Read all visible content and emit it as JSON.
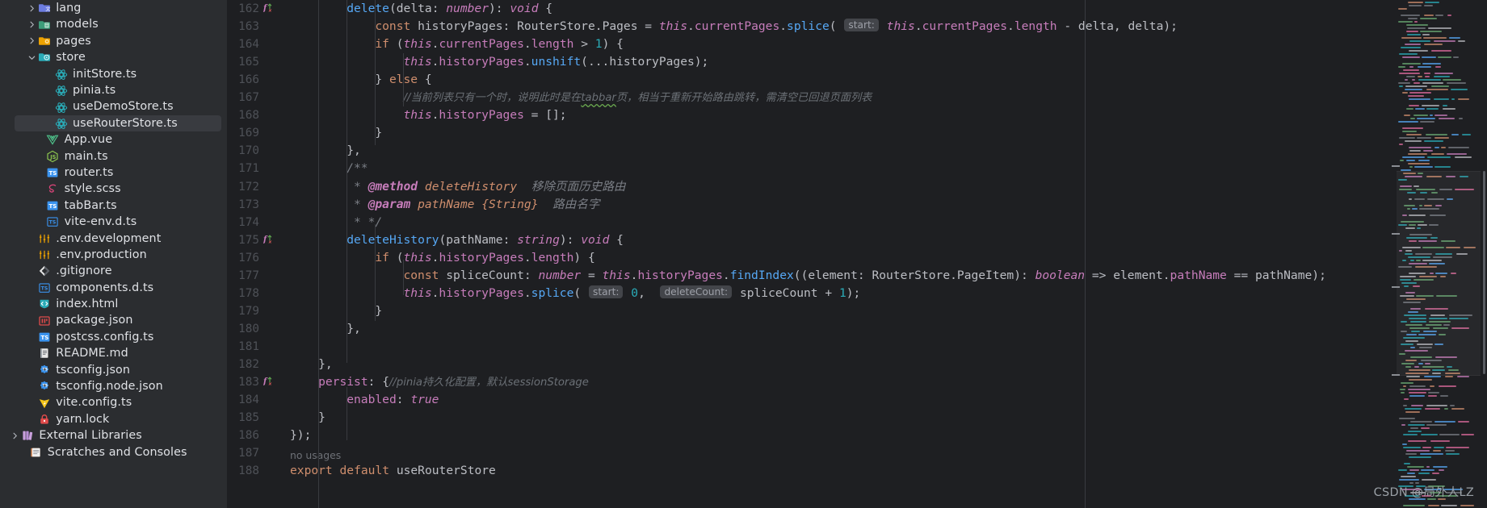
{
  "project_tree": {
    "items": [
      {
        "label": "lang",
        "icon": "folder-lang-icon",
        "indent": 3,
        "arrow": "right",
        "type": "folder",
        "selected": false
      },
      {
        "label": "models",
        "icon": "folder-models-icon",
        "indent": 3,
        "arrow": "right",
        "type": "folder",
        "selected": false
      },
      {
        "label": "pages",
        "icon": "folder-pages-icon",
        "indent": 3,
        "arrow": "right",
        "type": "folder",
        "selected": false
      },
      {
        "label": "store",
        "icon": "folder-store-icon",
        "indent": 3,
        "arrow": "down",
        "type": "folder",
        "selected": false
      },
      {
        "label": "initStore.ts",
        "icon": "pinia-store-icon",
        "indent": 5,
        "arrow": "none",
        "type": "file",
        "selected": false
      },
      {
        "label": "pinia.ts",
        "icon": "pinia-store-icon",
        "indent": 5,
        "arrow": "none",
        "type": "file",
        "selected": false
      },
      {
        "label": "useDemoStore.ts",
        "icon": "pinia-store-icon",
        "indent": 5,
        "arrow": "none",
        "type": "file",
        "selected": false
      },
      {
        "label": "useRouterStore.ts",
        "icon": "pinia-store-icon",
        "indent": 5,
        "arrow": "none",
        "type": "file",
        "selected": true
      },
      {
        "label": "App.vue",
        "icon": "vue-icon",
        "indent": 4,
        "arrow": "none",
        "type": "file",
        "selected": false
      },
      {
        "label": "main.ts",
        "icon": "js-icon",
        "indent": 4,
        "arrow": "none",
        "type": "file",
        "selected": false
      },
      {
        "label": "router.ts",
        "icon": "ts-icon",
        "indent": 4,
        "arrow": "none",
        "type": "file",
        "selected": false
      },
      {
        "label": "style.scss",
        "icon": "scss-icon",
        "indent": 4,
        "arrow": "none",
        "type": "file",
        "selected": false
      },
      {
        "label": "tabBar.ts",
        "icon": "ts-icon",
        "indent": 4,
        "arrow": "none",
        "type": "file",
        "selected": false
      },
      {
        "label": "vite-env.d.ts",
        "icon": "ts-def-icon",
        "indent": 4,
        "arrow": "none",
        "type": "file",
        "selected": false
      },
      {
        "label": ".env.development",
        "icon": "env-icon",
        "indent": 3,
        "arrow": "none",
        "type": "file",
        "selected": false
      },
      {
        "label": ".env.production",
        "icon": "env-icon",
        "indent": 3,
        "arrow": "none",
        "type": "file",
        "selected": false
      },
      {
        "label": ".gitignore",
        "icon": "gitignore-icon",
        "indent": 3,
        "arrow": "none",
        "type": "file",
        "selected": false
      },
      {
        "label": "components.d.ts",
        "icon": "ts-def-icon",
        "indent": 3,
        "arrow": "none",
        "type": "file",
        "selected": false
      },
      {
        "label": "index.html",
        "icon": "html-icon",
        "indent": 3,
        "arrow": "none",
        "type": "file",
        "selected": false
      },
      {
        "label": "package.json",
        "icon": "npm-icon",
        "indent": 3,
        "arrow": "none",
        "type": "file",
        "selected": false
      },
      {
        "label": "postcss.config.ts",
        "icon": "ts-icon",
        "indent": 3,
        "arrow": "none",
        "type": "file",
        "selected": false
      },
      {
        "label": "README.md",
        "icon": "markdown-icon",
        "indent": 3,
        "arrow": "none",
        "type": "file",
        "selected": false
      },
      {
        "label": "tsconfig.json",
        "icon": "tsconfig-icon",
        "indent": 3,
        "arrow": "none",
        "type": "file",
        "selected": false
      },
      {
        "label": "tsconfig.node.json",
        "icon": "tsconfig-icon",
        "indent": 3,
        "arrow": "none",
        "type": "file",
        "selected": false
      },
      {
        "label": "vite.config.ts",
        "icon": "vite-icon",
        "indent": 3,
        "arrow": "none",
        "type": "file",
        "selected": false
      },
      {
        "label": "yarn.lock",
        "icon": "lock-icon",
        "indent": 3,
        "arrow": "none",
        "type": "file",
        "selected": false
      },
      {
        "label": "External Libraries",
        "icon": "libraries-icon",
        "indent": 1,
        "arrow": "right",
        "type": "node",
        "selected": false
      },
      {
        "label": "Scratches and Consoles",
        "icon": "scratches-icon",
        "indent": 2,
        "arrow": "none",
        "type": "node",
        "selected": false
      }
    ]
  },
  "editor": {
    "first_line_number": 162,
    "gutter_marks": {
      "162": "override-method-icon",
      "175": "override-method-icon",
      "183": "override-method-icon"
    },
    "inlay_hints": {
      "163": "start:",
      "178_a": "start:",
      "178_b": "deleteCount:"
    },
    "no_usages_label": "no usages",
    "lines": [
      {
        "n": 162,
        "text": "        delete(delta: number): void {"
      },
      {
        "n": 163,
        "text": "            const historyPages: RouterStore.Pages = this.currentPages.splice( start: this.currentPages.length - delta, delta);"
      },
      {
        "n": 164,
        "text": "            if (this.currentPages.length > 1) {"
      },
      {
        "n": 165,
        "text": "                this.historyPages.unshift(...historyPages);"
      },
      {
        "n": 166,
        "text": "            } else {"
      },
      {
        "n": 167,
        "text": "                //当前列表只有一个时，说明此时是在tabbar页，相当于重新开始路由跳转，需清空已回退页面列表"
      },
      {
        "n": 168,
        "text": "                this.historyPages = [];"
      },
      {
        "n": 169,
        "text": "            }"
      },
      {
        "n": 170,
        "text": "        },"
      },
      {
        "n": 171,
        "text": "        /**"
      },
      {
        "n": 172,
        "text": "         * @method deleteHistory 移除页面历史路由"
      },
      {
        "n": 173,
        "text": "         * @param pathName {String} 路由名字"
      },
      {
        "n": 174,
        "text": "         * */"
      },
      {
        "n": 175,
        "text": "        deleteHistory(pathName: string): void {"
      },
      {
        "n": 176,
        "text": "            if (this.historyPages.length) {"
      },
      {
        "n": 177,
        "text": "                const spliceCount: number = this.historyPages.findIndex((element: RouterStore.PageItem): boolean => element.pathName == pathName);"
      },
      {
        "n": 178,
        "text": "                this.historyPages.splice( start: 0,  deleteCount: spliceCount + 1);"
      },
      {
        "n": 179,
        "text": "            }"
      },
      {
        "n": 180,
        "text": "        },"
      },
      {
        "n": 181,
        "text": ""
      },
      {
        "n": 182,
        "text": "    },"
      },
      {
        "n": 183,
        "text": "    persist: {//pinia持久化配置，默认sessionStorage"
      },
      {
        "n": 184,
        "text": "        enabled: true"
      },
      {
        "n": 185,
        "text": "    }"
      },
      {
        "n": 186,
        "text": "});"
      },
      {
        "n": 187,
        "text": ""
      },
      {
        "n": 188,
        "text": "export default useRouterStore"
      }
    ]
  },
  "watermark": {
    "text": "CSDN @局外人LZ"
  },
  "colors": {
    "background": "#1e1f22",
    "sidebar_background": "#2b2d30",
    "selection": "#393b40",
    "text": "#bcbec4",
    "line_number": "#4e5157",
    "comment": "#7a7e85",
    "keyword": "#cf8e6d",
    "keyword_italic": "#c77dbb",
    "function": "#56a8f5",
    "number": "#2aacb8",
    "string": "#6aab73",
    "inlay_hint_bg": "#43454a"
  }
}
